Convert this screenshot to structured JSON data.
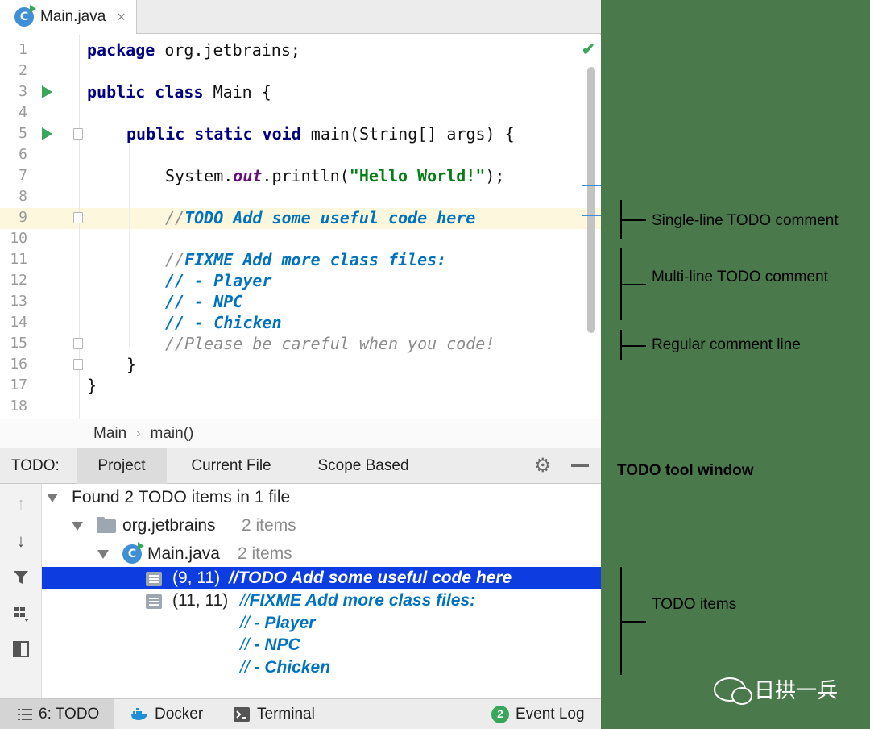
{
  "editor_tab": {
    "label": "Main.java",
    "close": "×",
    "icon": "class-icon"
  },
  "code_lines": [
    {
      "n": "1"
    },
    {
      "n": "2"
    },
    {
      "n": "3"
    },
    {
      "n": "4"
    },
    {
      "n": "5"
    },
    {
      "n": "6"
    },
    {
      "n": "7"
    },
    {
      "n": "8"
    },
    {
      "n": "9"
    },
    {
      "n": "10"
    },
    {
      "n": "11"
    },
    {
      "n": "12"
    },
    {
      "n": "13"
    },
    {
      "n": "14"
    },
    {
      "n": "15"
    },
    {
      "n": "16"
    },
    {
      "n": "17"
    },
    {
      "n": "18"
    }
  ],
  "code": {
    "l1_kw": "package",
    "l1_rest": " org.jetbrains;",
    "l3_kw": "public class",
    "l3_rest": " Main {",
    "l5_kw": "public static void",
    "l5_rest": " main(String[] args) {",
    "l7_a": "System.",
    "l7_field": "out",
    "l7_b": ".println(",
    "l7_str": "\"Hello World!\"",
    "l7_c": ");",
    "l9_slash": "//",
    "l9_todo": "TODO Add some useful code here",
    "l11_slash": "//",
    "l11_todo": "FIXME Add more class files:",
    "l12": "// - Player",
    "l13": "// - NPC",
    "l14": "// - Chicken",
    "l15": "//Please be careful when you code!",
    "l16": "}",
    "l17": "}"
  },
  "breadcrumb": {
    "item1": "Main",
    "sep": "›",
    "item2": "main()"
  },
  "todo_window": {
    "title": "TODO:",
    "tabs": [
      "Project",
      "Current File",
      "Scope Based"
    ],
    "found": "Found 2 TODO items in 1 file",
    "package": {
      "name": "org.jetbrains",
      "count": "2 items"
    },
    "file": {
      "name": "Main.java",
      "count": "2 items"
    },
    "items": [
      {
        "loc": "(9, 11)",
        "text": "//TODO Add some useful code here"
      },
      {
        "loc": "(11, 11)",
        "slash": "//",
        "text": "FIXME Add more class files:"
      }
    ],
    "continuation": [
      {
        "slash": "//",
        "text": " - Player"
      },
      {
        "slash": "//",
        "text": " - NPC"
      },
      {
        "slash": "//",
        "text": " - Chicken"
      }
    ]
  },
  "statusbar": {
    "todo": "6: TODO",
    "docker": "Docker",
    "terminal": "Terminal",
    "event_badge": "2",
    "event_log": "Event Log"
  },
  "annotations": {
    "single": "Single-line TODO comment",
    "multi": "Multi-line TODO comment",
    "regular": "Regular comment line",
    "toolwindow": "TODO tool window",
    "items": "TODO items"
  },
  "watermark": "日拱一兵",
  "colors": {
    "keyword": "#000080",
    "todo": "#0073bf",
    "string": "#067d17",
    "selection": "#0d3de0",
    "background": "#4a7a4b"
  }
}
